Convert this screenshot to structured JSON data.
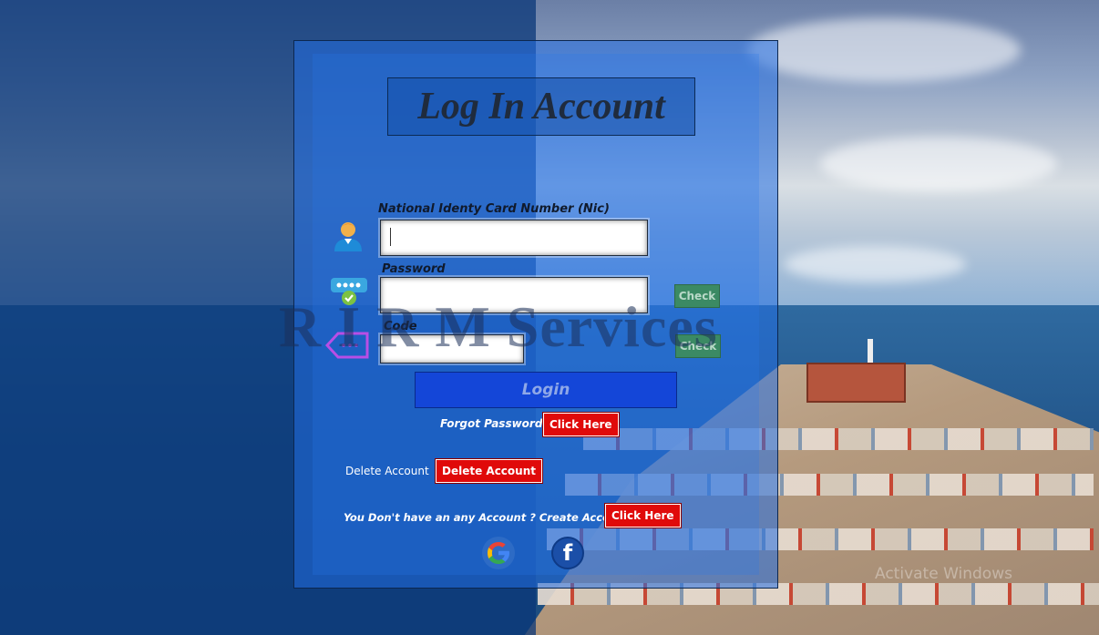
{
  "window": {
    "title": "Log In Account"
  },
  "brand": {
    "watermark": "R I R M Services"
  },
  "form": {
    "nic": {
      "label": "National Identy Card Number (Nic)",
      "value": ""
    },
    "password": {
      "label": "Password",
      "value": "",
      "check_label": "Check"
    },
    "code": {
      "label": "Code",
      "value": "",
      "check_label": "Check"
    },
    "login_label": "Login"
  },
  "links": {
    "forgot_text": "Forgot Password ?",
    "forgot_button": "Click Here",
    "delete_text": "Delete Account",
    "delete_button": "Delete Account",
    "create_text": "You Don't have an any Account ? Create Account",
    "create_button": "Click Here"
  },
  "social": {
    "google_icon": "google-icon",
    "facebook_icon": "facebook-icon",
    "facebook_glyph": "f"
  },
  "os_watermark": "Activate Windows",
  "colors": {
    "panel": "#236ee1",
    "login": "#1446d8",
    "danger": "#e00a0a",
    "check": "#3b8a64"
  }
}
